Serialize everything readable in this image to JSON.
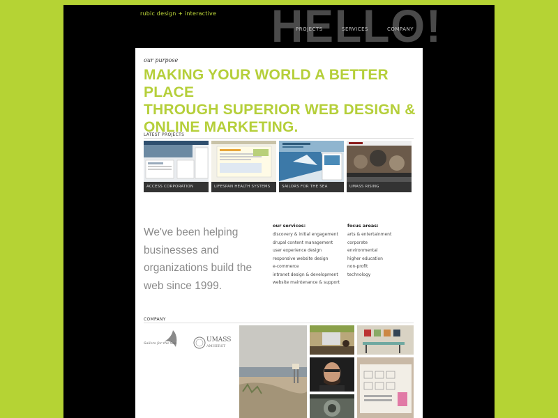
{
  "header": {
    "logo": "rubic design + interactive",
    "hello": "HELLO!",
    "nav": [
      "PROJECTS",
      "SERVICES",
      "COMPANY"
    ]
  },
  "purpose": {
    "label": "our purpose",
    "headline_lines": [
      "MAKING YOUR WORLD A BETTER PLACE",
      "THROUGH SUPERIOR WEB DESIGN &",
      "ONLINE MARKETING."
    ]
  },
  "projects": {
    "label": "LATEST PROJECTS",
    "items": [
      {
        "caption": "ACCESS CORPORATION"
      },
      {
        "caption": "LIFESPAN HEALTH SYSTEMS"
      },
      {
        "caption": "SAILORS FOR THE SEA"
      },
      {
        "caption": "UMASS RISING"
      }
    ]
  },
  "helping": {
    "lines": [
      "We've been helping",
      "businesses and",
      "organizations build the",
      "web since 1999."
    ]
  },
  "services": {
    "title": "our services:",
    "items": [
      "discovery & initial engagement",
      "drupal content management",
      "user experience design",
      "responsive website design",
      "e-commerce",
      "intranet design & development",
      "website maintenance & support"
    ]
  },
  "focus": {
    "title": "focus areas:",
    "items": [
      "arts & entertainment",
      "corporate",
      "environmental",
      "higher education",
      "non-profit",
      "technology"
    ]
  },
  "company": {
    "label": "COMPANY",
    "logo_sailors": "Sailors for the Sea",
    "logo_umass": "UMASS",
    "logo_umass_sub": "AMHERST"
  },
  "colors": {
    "accent": "#b5cf3a",
    "background": "#b5d334",
    "frame": "#000000"
  }
}
